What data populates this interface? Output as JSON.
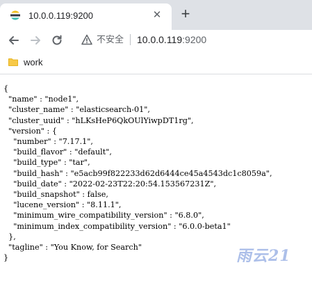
{
  "colors": {
    "tabstrip": "#dee1e6",
    "accent": "#1a73e8",
    "folder": "#f7c948"
  },
  "tab": {
    "favicon": "elasticsearch-logo",
    "title": "10.0.0.119:9200"
  },
  "toolbar": {
    "security_label": "不安全",
    "url_host": "10.0.0.119",
    "url_port": ":9200"
  },
  "bookmarks": [
    {
      "label": "work",
      "icon": "folder-icon"
    }
  ],
  "json_lines": [
    "{",
    "  \"name\" : \"node1\",",
    "  \"cluster_name\" : \"elasticsearch-01\",",
    "  \"cluster_uuid\" : \"hLKsHeP6QkOUlYiwpDT1rg\",",
    "  \"version\" : {",
    "    \"number\" : \"7.17.1\",",
    "    \"build_flavor\" : \"default\",",
    "    \"build_type\" : \"tar\",",
    "    \"build_hash\" : \"e5acb99f822233d62d6444ce45a4543dc1c8059a\",",
    "    \"build_date\" : \"2022-02-23T22:20:54.153567231Z\",",
    "    \"build_snapshot\" : false,",
    "    \"lucene_version\" : \"8.11.1\",",
    "    \"minimum_wire_compatibility_version\" : \"6.8.0\",",
    "    \"minimum_index_compatibility_version\" : \"6.0.0-beta1\"",
    "  },",
    "  \"tagline\" : \"You Know, for Search\"",
    "}"
  ],
  "watermark": "雨云21"
}
